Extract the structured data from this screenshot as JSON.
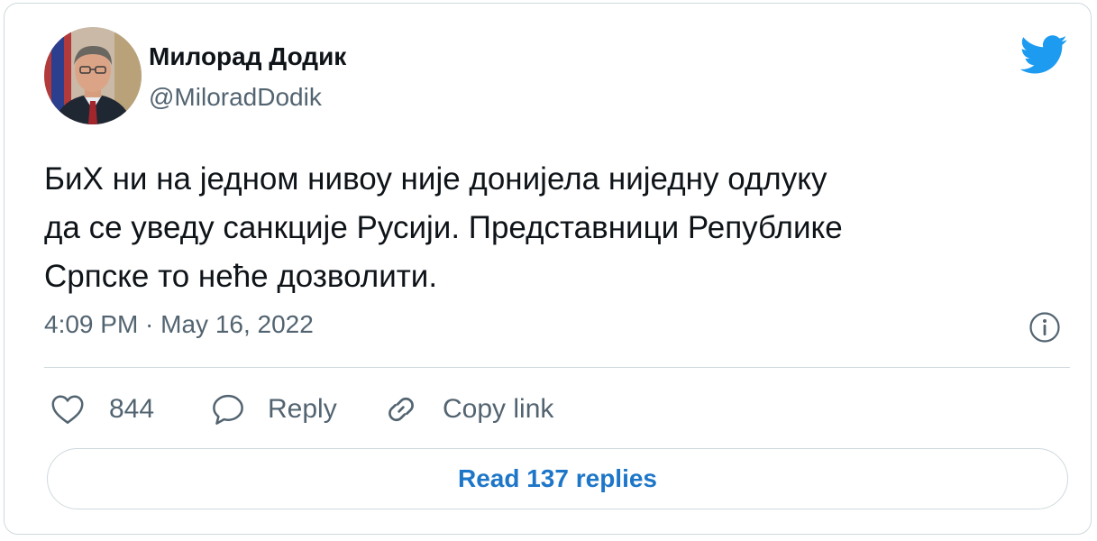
{
  "author": {
    "name": "Милорад Додик",
    "handle": "@MiloradDodik"
  },
  "tweet": {
    "lines": [
      "БиХ ни на једном нивоу није донијела ниједну одлуку",
      "да се уведу санкције Русији. Представници Републике",
      "Српске то неће дозволити."
    ],
    "timestamp": "4:09 PM · May 16, 2022"
  },
  "actions": {
    "like_count": "844",
    "reply_label": "Reply",
    "copy_link_label": "Copy link"
  },
  "read_replies_label": "Read 137 replies",
  "icons": {
    "brand": "twitter-bird-icon",
    "info": "info-icon",
    "like": "heart-icon",
    "reply": "speech-bubble-icon",
    "copy": "link-icon"
  },
  "colors": {
    "brand_blue": "#1d9bf0",
    "link_blue": "#1d76c8",
    "text_primary": "#0f1419",
    "text_secondary": "#536471",
    "border": "#cfd9de"
  }
}
